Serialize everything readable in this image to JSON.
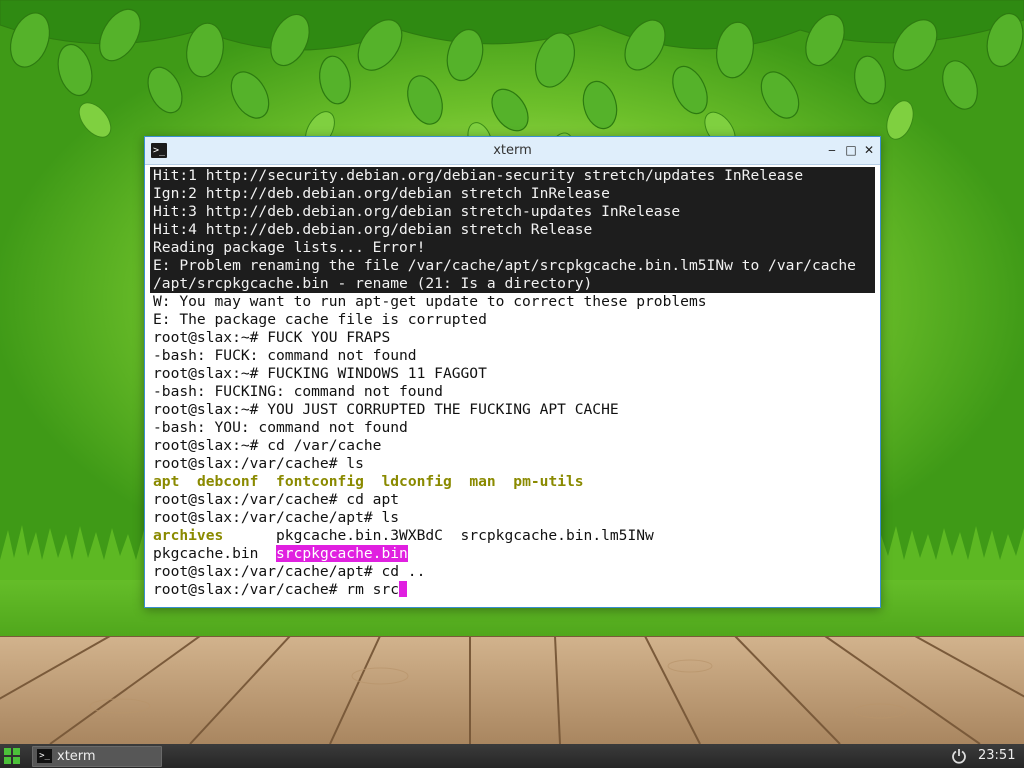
{
  "window": {
    "title": "xterm",
    "icon": "terminal-icon",
    "buttons": {
      "minimize": "‒",
      "maximize": "□",
      "close": "✕"
    }
  },
  "terminal": {
    "lines": [
      "Hit:1 http://security.debian.org/debian-security stretch/updates InRelease",
      "Ign:2 http://deb.debian.org/debian stretch InRelease",
      "Hit:3 http://deb.debian.org/debian stretch-updates InRelease",
      "Hit:4 http://deb.debian.org/debian stretch Release",
      "Reading package lists... Error!",
      "E: Problem renaming the file /var/cache/apt/srcpkgcache.bin.lm5INw to /var/cache",
      "/apt/srcpkgcache.bin - rename (21: Is a directory)",
      "W: You may want to run apt-get update to correct these problems",
      "E: The package cache file is corrupted",
      "root@slax:~# FUCK YOU FRAPS",
      "-bash: FUCK: command not found",
      "root@slax:~# FUCKING WINDOWS 11 FAGGOT",
      "-bash: FUCKING: command not found",
      "root@slax:~# YOU JUST CORRUPTED THE FUCKING APT CACHE",
      "-bash: YOU: command not found",
      "root@slax:~# cd /var/cache",
      "root@slax:/var/cache# ls"
    ],
    "ls_cache": [
      "apt",
      "debconf",
      "fontconfig",
      "ldconfig",
      "man",
      "pm-utils"
    ],
    "line_cd_apt": "root@slax:/var/cache# cd apt",
    "line_ls_apt": "root@slax:/var/cache/apt# ls",
    "ls_apt_row1": {
      "dir": "archives",
      "file1": "pkgcache.bin.3WXBdC",
      "file2": "srcpkgcache.bin.lm5INw"
    },
    "ls_apt_row2": {
      "file1": "pkgcache.bin",
      "highlighted": "srcpkgcache.bin"
    },
    "line_cd_up": "root@slax:/var/cache/apt# cd ..",
    "current_prompt": "root@slax:/var/cache# ",
    "current_input": "rm src"
  },
  "taskbar": {
    "start_icon": "grid-icon",
    "tasks": [
      {
        "label": "xterm",
        "icon": "terminal-icon"
      }
    ],
    "power_icon": "power-icon",
    "clock": "23:51"
  },
  "colors": {
    "highlight": "#e020e0",
    "directory": "#8a8a00",
    "terminal_dark_bg": "#1d1d1d"
  }
}
